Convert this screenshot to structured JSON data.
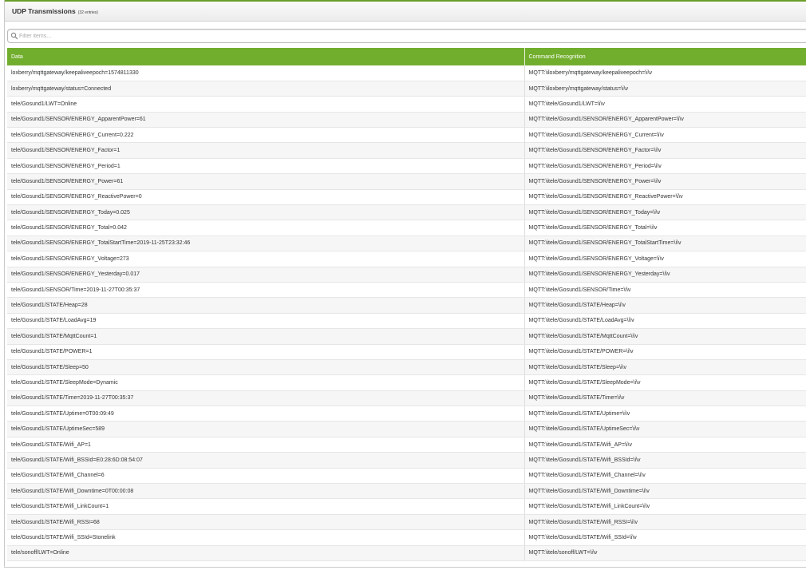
{
  "panel": {
    "title": "UDP Transmissions",
    "count": "(32 entries)"
  },
  "filter": {
    "placeholder": "Filter items...",
    "value": ""
  },
  "table": {
    "columns": [
      "Data",
      "Command Recognition"
    ],
    "rows": [
      [
        "loxberry/mqttgateway/keepaliveepoch=1574811330",
        "MQTT:\\iloxberry/mqttgateway/keepaliveepoch=\\i\\v"
      ],
      [
        "loxberry/mqttgateway/status=Connected",
        "MQTT:\\iloxberry/mqttgateway/status=\\i\\v"
      ],
      [
        "tele/Gosund1/LWT=Online",
        "MQTT:\\itele/Gosund1/LWT=\\i\\v"
      ],
      [
        "tele/Gosund1/SENSOR/ENERGY_ApparentPower=61",
        "MQTT:\\itele/Gosund1/SENSOR/ENERGY_ApparentPower=\\i\\v"
      ],
      [
        "tele/Gosund1/SENSOR/ENERGY_Current=0.222",
        "MQTT:\\itele/Gosund1/SENSOR/ENERGY_Current=\\i\\v"
      ],
      [
        "tele/Gosund1/SENSOR/ENERGY_Factor=1",
        "MQTT:\\itele/Gosund1/SENSOR/ENERGY_Factor=\\i\\v"
      ],
      [
        "tele/Gosund1/SENSOR/ENERGY_Period=1",
        "MQTT:\\itele/Gosund1/SENSOR/ENERGY_Period=\\i\\v"
      ],
      [
        "tele/Gosund1/SENSOR/ENERGY_Power=61",
        "MQTT:\\itele/Gosund1/SENSOR/ENERGY_Power=\\i\\v"
      ],
      [
        "tele/Gosund1/SENSOR/ENERGY_ReactivePower=0",
        "MQTT:\\itele/Gosund1/SENSOR/ENERGY_ReactivePower=\\i\\v"
      ],
      [
        "tele/Gosund1/SENSOR/ENERGY_Today=0.025",
        "MQTT:\\itele/Gosund1/SENSOR/ENERGY_Today=\\i\\v"
      ],
      [
        "tele/Gosund1/SENSOR/ENERGY_Total=0.042",
        "MQTT:\\itele/Gosund1/SENSOR/ENERGY_Total=\\i\\v"
      ],
      [
        "tele/Gosund1/SENSOR/ENERGY_TotalStartTime=2019-11-25T23:32:46",
        "MQTT:\\itele/Gosund1/SENSOR/ENERGY_TotalStartTime=\\i\\v"
      ],
      [
        "tele/Gosund1/SENSOR/ENERGY_Voltage=273",
        "MQTT:\\itele/Gosund1/SENSOR/ENERGY_Voltage=\\i\\v"
      ],
      [
        "tele/Gosund1/SENSOR/ENERGY_Yesterday=0.017",
        "MQTT:\\itele/Gosund1/SENSOR/ENERGY_Yesterday=\\i\\v"
      ],
      [
        "tele/Gosund1/SENSOR/Time=2019-11-27T00:35:37",
        "MQTT:\\itele/Gosund1/SENSOR/Time=\\i\\v"
      ],
      [
        "tele/Gosund1/STATE/Heap=28",
        "MQTT:\\itele/Gosund1/STATE/Heap=\\i\\v"
      ],
      [
        "tele/Gosund1/STATE/LoadAvg=19",
        "MQTT:\\itele/Gosund1/STATE/LoadAvg=\\i\\v"
      ],
      [
        "tele/Gosund1/STATE/MqttCount=1",
        "MQTT:\\itele/Gosund1/STATE/MqttCount=\\i\\v"
      ],
      [
        "tele/Gosund1/STATE/POWER=1",
        "MQTT:\\itele/Gosund1/STATE/POWER=\\i\\v"
      ],
      [
        "tele/Gosund1/STATE/Sleep=50",
        "MQTT:\\itele/Gosund1/STATE/Sleep=\\i\\v"
      ],
      [
        "tele/Gosund1/STATE/SleepMode=Dynamic",
        "MQTT:\\itele/Gosund1/STATE/SleepMode=\\i\\v"
      ],
      [
        "tele/Gosund1/STATE/Time=2019-11-27T00:35:37",
        "MQTT:\\itele/Gosund1/STATE/Time=\\i\\v"
      ],
      [
        "tele/Gosund1/STATE/Uptime=0T00:09:49",
        "MQTT:\\itele/Gosund1/STATE/Uptime=\\i\\v"
      ],
      [
        "tele/Gosund1/STATE/UptimeSec=589",
        "MQTT:\\itele/Gosund1/STATE/UptimeSec=\\i\\v"
      ],
      [
        "tele/Gosund1/STATE/Wifi_AP=1",
        "MQTT:\\itele/Gosund1/STATE/Wifi_AP=\\i\\v"
      ],
      [
        "tele/Gosund1/STATE/Wifi_BSSId=E0:28:6D:08:54:07",
        "MQTT:\\itele/Gosund1/STATE/Wifi_BSSId=\\i\\v"
      ],
      [
        "tele/Gosund1/STATE/Wifi_Channel=6",
        "MQTT:\\itele/Gosund1/STATE/Wifi_Channel=\\i\\v"
      ],
      [
        "tele/Gosund1/STATE/Wifi_Downtime=0T00:00:08",
        "MQTT:\\itele/Gosund1/STATE/Wifi_Downtime=\\i\\v"
      ],
      [
        "tele/Gosund1/STATE/Wifi_LinkCount=1",
        "MQTT:\\itele/Gosund1/STATE/Wifi_LinkCount=\\i\\v"
      ],
      [
        "tele/Gosund1/STATE/Wifi_RSSI=68",
        "MQTT:\\itele/Gosund1/STATE/Wifi_RSSI=\\i\\v"
      ],
      [
        "tele/Gosund1/STATE/Wifi_SSId=Stonelink",
        "MQTT:\\itele/Gosund1/STATE/Wifi_SSId=\\i\\v"
      ],
      [
        "tele/sonoff/LWT=Online",
        "MQTT:\\itele/sonoff/LWT=\\i\\v"
      ]
    ]
  },
  "colors": {
    "header_green": "#72ae2d",
    "accent_border": "#6a9e2a"
  },
  "icons": {
    "filter": "search-icon",
    "watermark": "loxberry-logo-watermark"
  }
}
